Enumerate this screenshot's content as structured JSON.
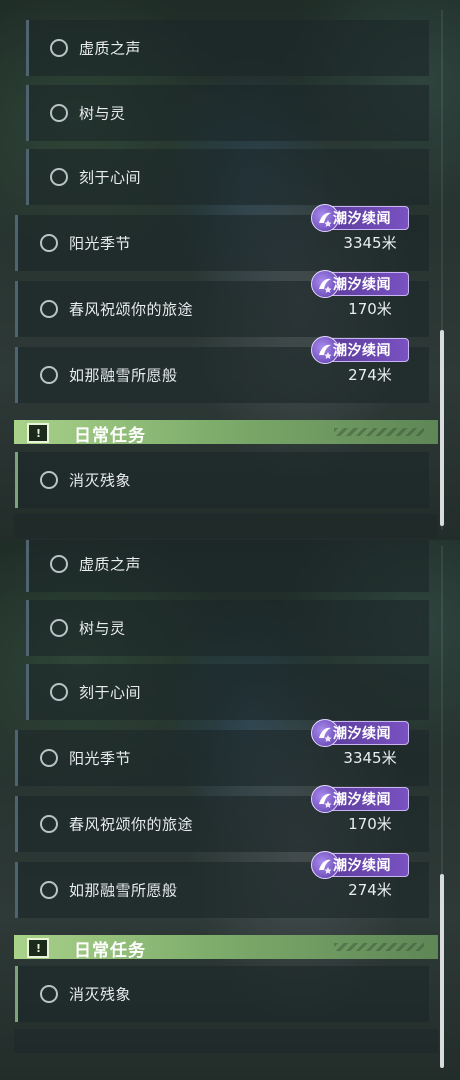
{
  "quests": {
    "a": "虚质之声",
    "b": "树与灵",
    "c": "刻于心间",
    "d": "阳光季节",
    "e": "春风祝颂你的旅途",
    "f": "如那融雪所愿般"
  },
  "badge_label": "潮汐续闻",
  "distances": {
    "d": "3345米",
    "e": "170米",
    "f": "274米"
  },
  "daily": {
    "title": "日常任务",
    "item": "消灭残象"
  },
  "colors": {
    "badge": "#6b47b3",
    "daily_header": "#9cc87f",
    "row_bg": "#1c2628"
  },
  "icons": [
    "radio-circle-icon",
    "tidal-emblem-icon",
    "alert-icon"
  ]
}
